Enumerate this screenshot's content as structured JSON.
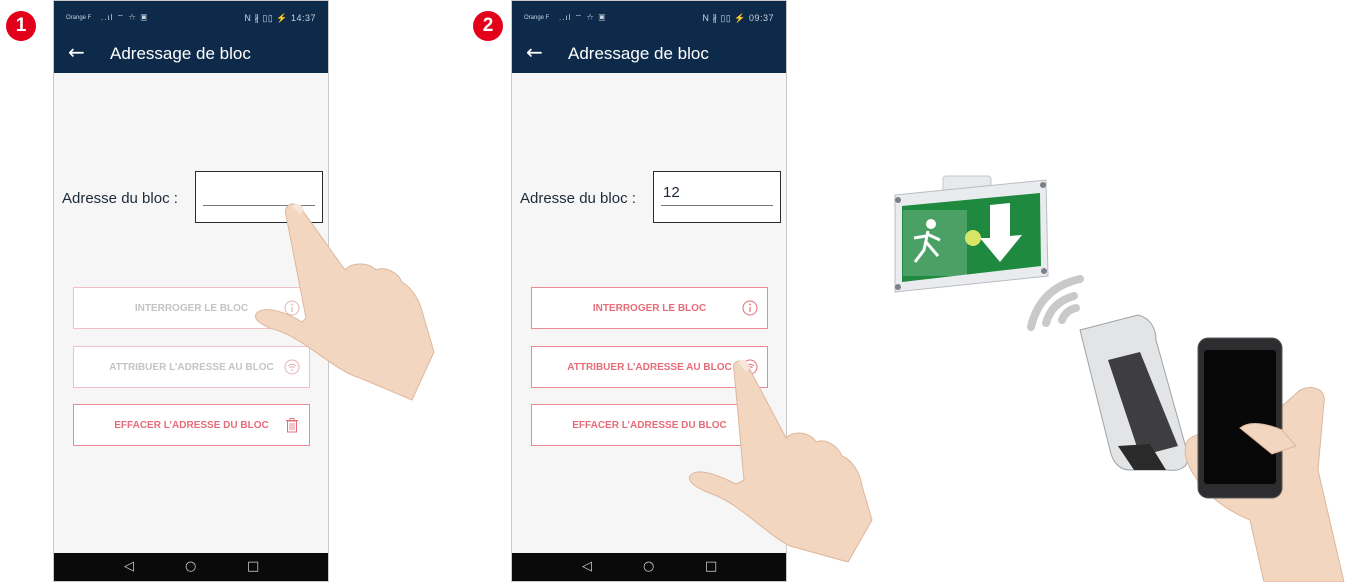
{
  "steps": {
    "step1": "1",
    "step2": "2"
  },
  "phone1": {
    "status": {
      "carrier": "Orange F",
      "signal": "..ıl ⌔ ☆ ▣",
      "right": "N ∦ ▯▯ ⚡ 14:37"
    },
    "appbar": {
      "back": "←",
      "title": "Adressage de bloc"
    },
    "field": {
      "label": "Adresse du bloc :",
      "value": ""
    },
    "buttons": [
      {
        "label": "INTERROGER LE BLOC",
        "icon": "info-icon"
      },
      {
        "label": "ATTRIBUER L’ADRESSE AU BLOC",
        "icon": "wifi-circle-icon"
      },
      {
        "label": "EFFACER L’ADRESSE DU BLOC",
        "icon": "trash-icon"
      }
    ],
    "nav": {
      "back": "◁",
      "home": "○",
      "recent": "□"
    }
  },
  "phone2": {
    "status": {
      "carrier": "Orange F",
      "signal": "..ıl ⌔ ☆ ▣",
      "right": "N ∦ ▯▯ ⚡ 09:37"
    },
    "appbar": {
      "back": "←",
      "title": "Adressage de bloc"
    },
    "field": {
      "label": "Adresse du bloc :",
      "value": "12"
    },
    "buttons": [
      {
        "label": "INTERROGER LE BLOC",
        "icon": "info-icon"
      },
      {
        "label": "ATTRIBUER L’ADRESSE AU BLOC",
        "icon": "wifi-circle-icon"
      },
      {
        "label": "EFFACER L’ADRESSE DU BLOC",
        "icon": "trash-icon"
      }
    ],
    "nav": {
      "back": "◁",
      "home": "○",
      "recent": "□"
    }
  },
  "colors": {
    "step_badge": "#e3001b",
    "appbar": "#0d2a4a",
    "button_text": "#e66c79",
    "button_border": "#ec8a94",
    "exit_sign": "#1f8a3f"
  }
}
